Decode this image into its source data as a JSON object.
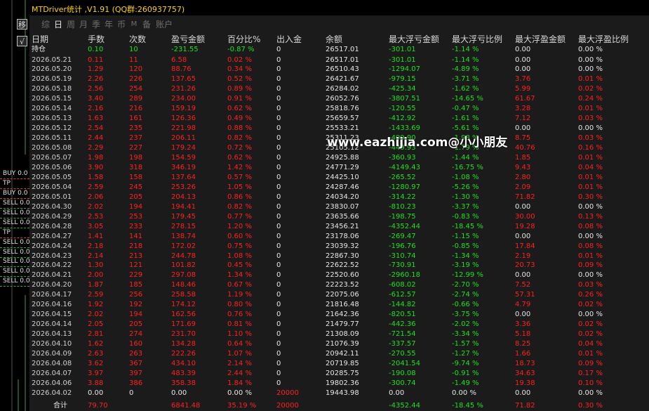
{
  "app": {
    "title": "MTDriver统计 ,V1.91 (QQ群:260937757)",
    "side_buttons": [
      "移",
      "√"
    ],
    "tabs": [
      "综",
      "日",
      "周",
      "月",
      "季",
      "年",
      "币",
      "M",
      "备",
      "账户"
    ],
    "active_tab": "日"
  },
  "watermark": "www.eazhijia.com@小小朋友",
  "side_labels": [
    {
      "text": "BUY 0.0",
      "row": 12
    },
    {
      "text": "TP",
      "row": 13
    },
    {
      "text": "BUY 0.0",
      "row": 14
    },
    {
      "text": "SELL 0.0",
      "row": 15
    },
    {
      "text": "SELL 0.0",
      "row": 16
    },
    {
      "text": "SELL 0.0",
      "row": 17
    },
    {
      "text": "TP",
      "row": 18
    },
    {
      "text": "SELL 0.0",
      "row": 19
    },
    {
      "text": "SELL 0.0",
      "row": 20
    },
    {
      "text": "SELL 0.0",
      "row": 21
    },
    {
      "text": "SELL 0.0",
      "row": 22
    },
    {
      "text": "SELL 0.0",
      "row": 23
    }
  ],
  "table": {
    "headers": [
      "日期",
      "手数",
      "次数",
      "盈亏金额",
      "百分比%",
      "出入金",
      "余额",
      "最大浮亏金额",
      "最大浮亏比例",
      "最大浮盈金额",
      "最大浮盈比例"
    ],
    "holding": {
      "label": "持仓",
      "lots": "0.10",
      "count": "10",
      "pnl": "-231.55",
      "pct": "-0.87 %",
      "io": "0",
      "balance": "26517.01",
      "max_loss": "-301.01",
      "max_loss_pct": "-1.14 %",
      "max_profit": "0.00",
      "max_profit_pct": "0.00 %"
    },
    "rows": [
      [
        "2026.05.21",
        "0.11",
        "11",
        "6.58",
        "0.02 %",
        "0",
        "26517.01",
        "-301.01",
        "-1.14 %",
        "0.00",
        "0.00 %"
      ],
      [
        "2026.05.20",
        "1.29",
        "120",
        "88.76",
        "0.34 %",
        "0",
        "26510.43",
        "-1294.07",
        "-4.89 %",
        "0.00",
        "0.00 %"
      ],
      [
        "2026.05.19",
        "2.26",
        "226",
        "137.65",
        "0.52 %",
        "0",
        "26421.67",
        "-979.15",
        "-3.71 %",
        "3.76",
        "0.01 %"
      ],
      [
        "2026.05.18",
        "2.56",
        "254",
        "231.26",
        "0.89 %",
        "0",
        "26284.02",
        "-425.34",
        "-1.62 %",
        "5.99",
        "0.02 %"
      ],
      [
        "2026.05.15",
        "3.40",
        "289",
        "234.00",
        "0.91 %",
        "0",
        "26052.76",
        "-3807.51",
        "-14.65 %",
        "61.67",
        "0.24 %"
      ],
      [
        "2026.05.14",
        "2.16",
        "216",
        "159.19",
        "0.62 %",
        "0",
        "25818.76",
        "-120.55",
        "-0.47 %",
        "3.28",
        "0.01 %"
      ],
      [
        "2026.05.13",
        "1.63",
        "161",
        "126.36",
        "0.49 %",
        "0",
        "25659.57",
        "-412.92",
        "-1.61 %",
        "7.12",
        "0.03 %"
      ],
      [
        "2026.05.12",
        "2.54",
        "235",
        "221.98",
        "0.88 %",
        "0",
        "25533.21",
        "-1433.69",
        "-5.61 %",
        "0.00",
        "0.00 %"
      ],
      [
        "2026.05.11",
        "2.44",
        "237",
        "206.11",
        "0.82 %",
        "0",
        "25311.23",
        "-499.90",
        "-1.98 %",
        "8.75",
        "0.03 %"
      ],
      [
        "2026.05.08",
        "2.29",
        "227",
        "179.24",
        "0.72 %",
        "0",
        "25105.12",
        "-449.93",
        "-1.79 %",
        "40.76",
        "0.16 %"
      ],
      [
        "2026.05.07",
        "1.98",
        "198",
        "154.59",
        "0.62 %",
        "0",
        "24925.88",
        "-360.93",
        "-1.44 %",
        "1.85",
        "0.01 %"
      ],
      [
        "2026.05.06",
        "3.90",
        "318",
        "346.19",
        "1.42 %",
        "0",
        "24771.29",
        "-4149.43",
        "-16.75 %",
        "9.43",
        "0.04 %"
      ],
      [
        "2026.05.05",
        "1.58",
        "158",
        "137.64",
        "0.57 %",
        "0",
        "24425.10",
        "-265.52",
        "-1.08 %",
        "2.80",
        "0.01 %"
      ],
      [
        "2026.05.04",
        "2.59",
        "245",
        "253.26",
        "1.05 %",
        "0",
        "24287.46",
        "-1280.97",
        "-5.26 %",
        "2.09",
        "0.01 %"
      ],
      [
        "2026.05.01",
        "2.06",
        "205",
        "204.13",
        "0.86 %",
        "0",
        "24034.20",
        "-314.22",
        "-1.30 %",
        "71.82",
        "0.30 %"
      ],
      [
        "2026.04.30",
        "2.02",
        "194",
        "194.41",
        "0.82 %",
        "0",
        "23830.07",
        "-810.23",
        "-3.37 %",
        "0.00",
        "0.00 %"
      ],
      [
        "2026.04.29",
        "2.53",
        "253",
        "179.45",
        "0.77 %",
        "0",
        "23635.66",
        "-198.75",
        "-0.83 %",
        "30.00",
        "0.13 %"
      ],
      [
        "2026.04.28",
        "3.05",
        "233",
        "278.15",
        "1.20 %",
        "0",
        "23456.21",
        "-4352.44",
        "-18.45 %",
        "19.28",
        "0.08 %"
      ],
      [
        "2026.04.27",
        "1.41",
        "141",
        "138.74",
        "0.60 %",
        "0",
        "23178.06",
        "-269.47",
        "-1.15 %",
        "0.00",
        "0.00 %"
      ],
      [
        "2026.04.24",
        "2.18",
        "218",
        "172.02",
        "0.75 %",
        "0",
        "23039.32",
        "-196.76",
        "-0.85 %",
        "17.84",
        "0.08 %"
      ],
      [
        "2026.04.23",
        "2.14",
        "213",
        "244.78",
        "1.08 %",
        "0",
        "22867.30",
        "-310.74",
        "-1.34 %",
        "2.19",
        "0.01 %"
      ],
      [
        "2026.04.22",
        "1.30",
        "121",
        "101.82",
        "0.45 %",
        "0",
        "22622.52",
        "-730.91",
        "-3.19 %",
        "20.73",
        "0.09 %"
      ],
      [
        "2026.04.21",
        "2.00",
        "229",
        "297.08",
        "1.34 %",
        "0",
        "22520.60",
        "-2960.18",
        "-12.99 %",
        "0.00",
        "0.00 %"
      ],
      [
        "2026.04.20",
        "1.87",
        "185",
        "148.46",
        "0.67 %",
        "0",
        "22223.52",
        "-608.02",
        "-2.70 %",
        "7.52",
        "0.03 %"
      ],
      [
        "2026.04.17",
        "2.59",
        "256",
        "258.58",
        "1.19 %",
        "0",
        "22075.06",
        "-612.57",
        "-2.74 %",
        "57.31",
        "0.26 %"
      ],
      [
        "2026.04.16",
        "1.92",
        "192",
        "174.12",
        "0.80 %",
        "0",
        "21816.48",
        "-144.82",
        "-0.66 %",
        "4.79",
        "0.02 %"
      ],
      [
        "2026.04.15",
        "2.02",
        "194",
        "162.56",
        "0.76 %",
        "0",
        "21642.36",
        "-820.51",
        "-3.75 %",
        "0.00",
        "0.00 %"
      ],
      [
        "2026.04.14",
        "2.05",
        "205",
        "171.69",
        "0.81 %",
        "0",
        "21479.77",
        "-442.36",
        "-2.02 %",
        "3.36",
        "0.02 %"
      ],
      [
        "2026.04.13",
        "2.81",
        "274",
        "231.70",
        "1.10 %",
        "0",
        "21308.09",
        "-721.54",
        "-3.34 %",
        "5.18",
        "0.02 %"
      ],
      [
        "2026.04.10",
        "1.62",
        "160",
        "134.28",
        "0.64 %",
        "0",
        "21076.39",
        "-337.57",
        "-1.57 %",
        "8.25",
        "0.04 %"
      ],
      [
        "2026.04.09",
        "2.63",
        "263",
        "222.26",
        "1.07 %",
        "0",
        "20942.11",
        "-270.55",
        "-1.27 %",
        "1.66",
        "0.01 %"
      ],
      [
        "2026.04.08",
        "3.62",
        "367",
        "434.10",
        "2.14 %",
        "0",
        "20719.85",
        "-2041.54",
        "-9.74 %",
        "18.73",
        "0.09 %"
      ],
      [
        "2026.04.07",
        "3.97",
        "397",
        "483.39",
        "2.44 %",
        "0",
        "20285.75",
        "-190.08",
        "-0.91 %",
        "34.63",
        "0.17 %"
      ],
      [
        "2026.04.06",
        "3.88",
        "386",
        "358.38",
        "1.84 %",
        "0",
        "19802.36",
        "-300.74",
        "-1.49 %",
        "19.38",
        "0.10 %"
      ],
      [
        "2026.04.02",
        "0.00",
        "0",
        "0.00",
        "0.00 %",
        "20000",
        "19443.98",
        "0.00",
        "0.00 %",
        "0.00",
        "0.00 %"
      ]
    ],
    "total": {
      "label": "合计",
      "lots": "79.70",
      "count": "",
      "pnl": "6841.48",
      "pct": "35.19 %",
      "io": "20000",
      "balance": "",
      "max_loss": "-4352.44",
      "max_loss_pct": "-18.45 %",
      "max_profit": "71.82",
      "max_profit_pct": "0.30 %"
    }
  },
  "colors": {
    "positive": "#ff2020",
    "negative": "#1ee01e",
    "neutral": "#e6e6e6",
    "title": "#ffd400",
    "panel": "#1b1b1b"
  }
}
